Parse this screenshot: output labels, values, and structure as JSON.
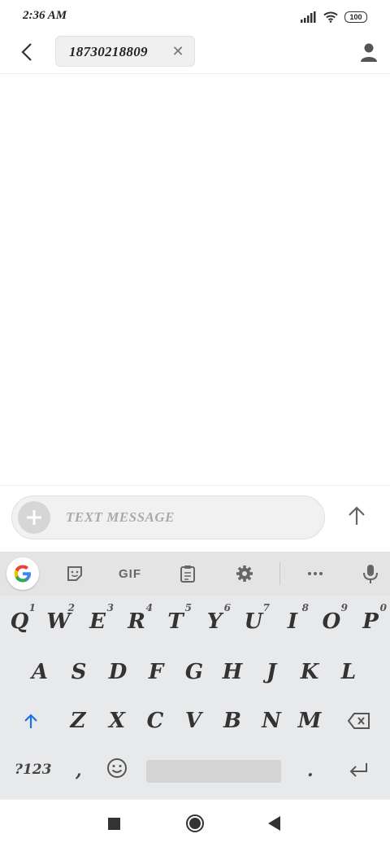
{
  "status": {
    "time": "2:36 AM",
    "battery": "100"
  },
  "header": {
    "recipient": "18730218809"
  },
  "compose": {
    "placeholder": "TEXT MESSAGE"
  },
  "keyboard": {
    "toolbar": {
      "gif_label": "GIF"
    },
    "row1": [
      {
        "key": "Q",
        "hint": "1"
      },
      {
        "key": "W",
        "hint": "2"
      },
      {
        "key": "E",
        "hint": "3"
      },
      {
        "key": "R",
        "hint": "4"
      },
      {
        "key": "T",
        "hint": "5"
      },
      {
        "key": "Y",
        "hint": "6"
      },
      {
        "key": "U",
        "hint": "7"
      },
      {
        "key": "I",
        "hint": "8"
      },
      {
        "key": "O",
        "hint": "9"
      },
      {
        "key": "P",
        "hint": "0"
      }
    ],
    "row2": [
      "A",
      "S",
      "D",
      "F",
      "G",
      "H",
      "J",
      "K",
      "L"
    ],
    "row3": [
      "Z",
      "X",
      "C",
      "V",
      "B",
      "N",
      "M"
    ],
    "symbols_label": "?123",
    "comma": ",",
    "period": "."
  },
  "colors": {
    "accent": "#1a73e8",
    "keyboard_bg": "#e8e9eb"
  },
  "icons": [
    "back-arrow-icon",
    "close-icon",
    "person-icon",
    "plus-icon",
    "send-arrow-icon",
    "google-icon",
    "sticker-icon",
    "clipboard-icon",
    "gear-icon",
    "more-icon",
    "mic-icon",
    "shift-icon",
    "backspace-icon",
    "emoji-icon",
    "enter-icon"
  ]
}
